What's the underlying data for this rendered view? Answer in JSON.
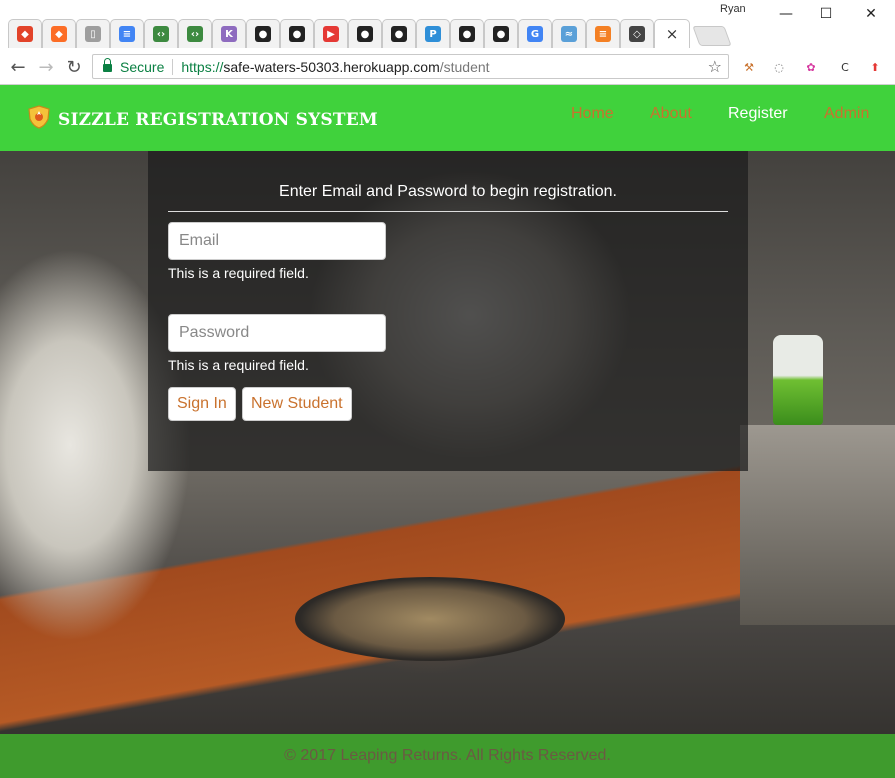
{
  "browser": {
    "profile_name": "Ryan",
    "tabs": [
      {
        "icon": "gitlab-icon",
        "glyph": "◆",
        "color": "#e2432a"
      },
      {
        "icon": "gitlab-icon",
        "glyph": "◆",
        "color": "#fc6d26"
      },
      {
        "icon": "blank-page-icon",
        "glyph": "▯",
        "color": "#9e9e9e"
      },
      {
        "icon": "google-docs-icon",
        "glyph": "≡",
        "color": "#4285f4"
      },
      {
        "icon": "code-icon",
        "glyph": "‹›",
        "color": "#3d8a40"
      },
      {
        "icon": "code-icon",
        "glyph": "‹›",
        "color": "#3d8a40"
      },
      {
        "icon": "k-icon",
        "glyph": "K",
        "color": "#8e6bbf"
      },
      {
        "icon": "github-icon",
        "glyph": "●",
        "color": "#222"
      },
      {
        "icon": "github-icon",
        "glyph": "●",
        "color": "#222"
      },
      {
        "icon": "youtube-icon",
        "glyph": "▶",
        "color": "#e53935"
      },
      {
        "icon": "github-icon",
        "glyph": "●",
        "color": "#222"
      },
      {
        "icon": "github-icon",
        "glyph": "●",
        "color": "#222"
      },
      {
        "icon": "p-icon",
        "glyph": "P",
        "color": "#2f8fd8"
      },
      {
        "icon": "github-icon",
        "glyph": "●",
        "color": "#222"
      },
      {
        "icon": "github-icon",
        "glyph": "●",
        "color": "#222"
      },
      {
        "icon": "google-icon",
        "glyph": "G",
        "color": "#4285f4"
      },
      {
        "icon": "wave-icon",
        "glyph": "≈",
        "color": "#5aa0d8"
      },
      {
        "icon": "stack-icon",
        "glyph": "≡",
        "color": "#f48024"
      },
      {
        "icon": "codepen-icon",
        "glyph": "◇",
        "color": "#444"
      }
    ],
    "active_tab_close": "×",
    "window_controls": {
      "minimize": "—",
      "maximize": "☐",
      "close": "✕"
    },
    "nav": {
      "back": "←",
      "forward": "→",
      "reload": "↻"
    },
    "address": {
      "secure_label": "Secure",
      "protocol": "https://",
      "host": "safe-waters-50303.herokuapp.com",
      "path": "/student"
    },
    "bookmark_star": "☆",
    "extensions": [
      {
        "icon": "hammer-extension-icon",
        "glyph": "⚒",
        "color": "#c9722e"
      },
      {
        "icon": "ring-extension-icon",
        "glyph": "◌",
        "color": "#777"
      },
      {
        "icon": "colorwheel-extension-icon",
        "glyph": "✿",
        "color": "#d63aa0"
      },
      {
        "icon": "c-off-extension-icon",
        "glyph": "C",
        "color": "#333"
      },
      {
        "icon": "red-up-extension-icon",
        "glyph": "⬆",
        "color": "#e53935"
      }
    ]
  },
  "site": {
    "brand": "SIZZLE REGISTRATION SYSTEM",
    "nav": [
      {
        "label": "Home"
      },
      {
        "label": "About"
      },
      {
        "label": "Register"
      },
      {
        "label": "Admin"
      }
    ],
    "accent_color": "#40d23c",
    "link_color": "#c9722e"
  },
  "form": {
    "title": "Enter Email and Password to begin registration.",
    "email_placeholder": "Email",
    "email_error": "This is a required field.",
    "password_placeholder": "Password",
    "password_error": "This is a required field.",
    "sign_in_label": "Sign In",
    "new_student_label": "New Student"
  },
  "footer": {
    "text": "© 2017 Leaping Returns. All Rights Reserved."
  }
}
